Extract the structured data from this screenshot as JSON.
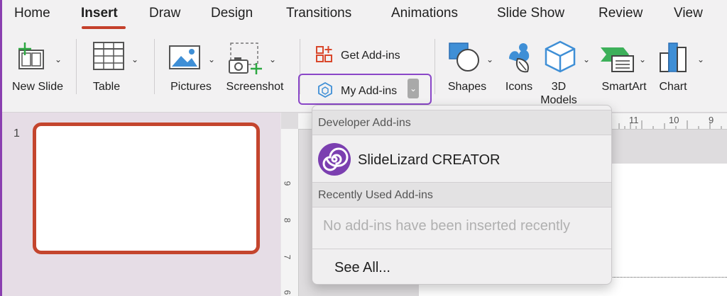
{
  "tabs": [
    "Home",
    "Insert",
    "Draw",
    "Design",
    "Transitions",
    "Animations",
    "Slide Show",
    "Review",
    "View"
  ],
  "ribbon": {
    "new_slide": "New Slide",
    "table": "Table",
    "pictures": "Pictures",
    "screenshot": "Screenshot",
    "get_addins": "Get Add-ins",
    "my_addins": "My Add-ins",
    "shapes": "Shapes",
    "icons": "Icons",
    "models_3d": "3D Models",
    "smartart": "SmartArt",
    "chart": "Chart"
  },
  "slides": {
    "number": "1"
  },
  "ruler": {
    "top_numbers": [
      "11",
      "10",
      "9"
    ],
    "left_numbers": [
      "9",
      "8",
      "7",
      "6"
    ]
  },
  "dropdown": {
    "developer_header": "Developer Add-ins",
    "slidelizard": "SlideLizard CREATOR",
    "recent_header": "Recently Used Add-ins",
    "empty_message": "No add-ins have been inserted recently",
    "see_all": "See All..."
  },
  "colors": {
    "accent": "#c4402b",
    "highlight": "#8a46c8",
    "slidelizard": "#7b3fb0"
  }
}
